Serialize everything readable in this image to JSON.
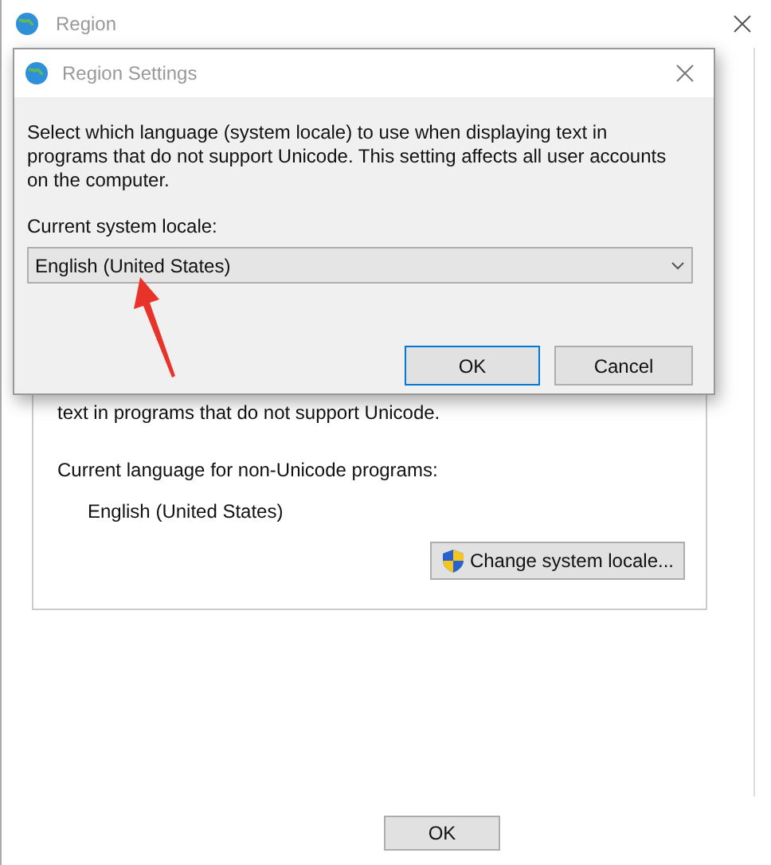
{
  "window": {
    "title": "Region"
  },
  "panel": {
    "description": "text in programs that do not support Unicode.",
    "current_label": "Current language for non-Unicode programs:",
    "current_value": "English (United States)",
    "change_button": "Change system locale..."
  },
  "buttons": [
    "OK"
  ],
  "dialog": {
    "title": "Region Settings",
    "message": "Select which language (system locale) to use when displaying text in programs that do not support Unicode. This setting affects all user accounts on the computer.",
    "locale_label": "Current system locale:",
    "locale_value": "English (United States)",
    "buttons": [
      "OK",
      "Cancel"
    ]
  }
}
